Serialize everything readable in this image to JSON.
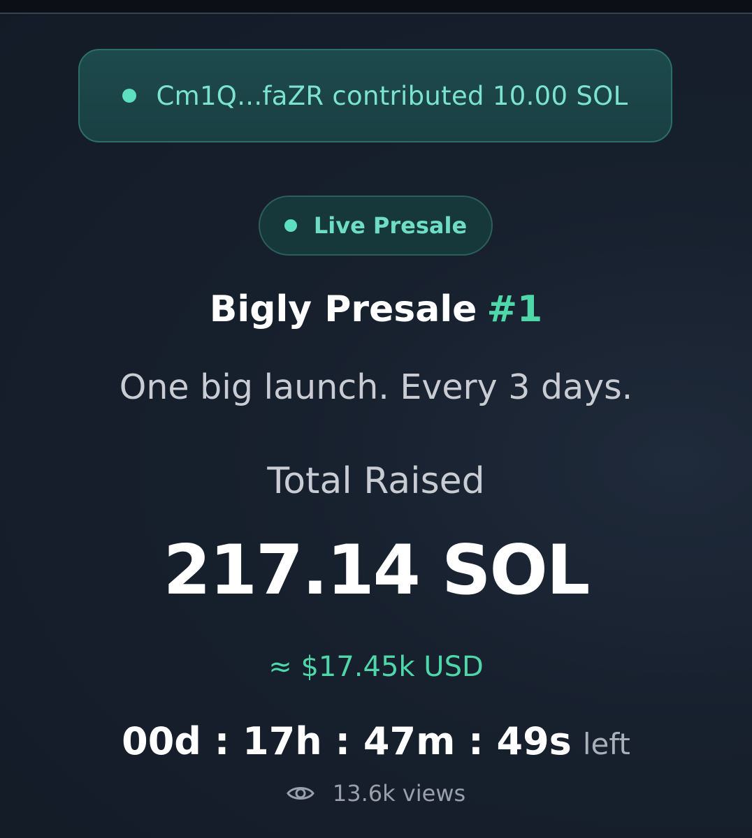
{
  "toast": {
    "text": "Cm1Q...faZR contributed 10.00 SOL",
    "dot_color": "#5ee0c0"
  },
  "status_pill": {
    "label": "Live Presale"
  },
  "presale": {
    "title": "Bigly Presale",
    "number": "#1",
    "tagline": "One big launch. Every 3 days."
  },
  "raised": {
    "label": "Total Raised",
    "amount": "217.14 SOL",
    "usd": "≈ $17.45k USD"
  },
  "countdown": {
    "time": "00d : 17h : 47m : 49s",
    "suffix": "left"
  },
  "stats": {
    "views": "13.6k views",
    "views_icon": "eye-icon"
  },
  "colors": {
    "accent": "#4fd7a9",
    "background": "#161f2b"
  }
}
